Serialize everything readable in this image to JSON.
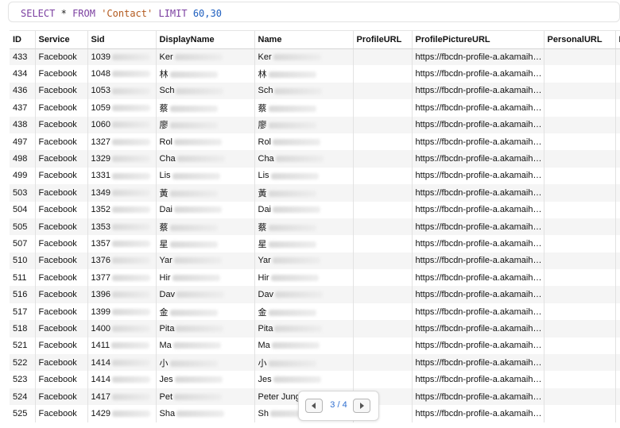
{
  "query": {
    "select": "SELECT",
    "star": "*",
    "from": "FROM",
    "table": "'Contact'",
    "limit": "LIMIT",
    "range": "60,30"
  },
  "columns": [
    "ID",
    "Service",
    "Sid",
    "DisplayName",
    "Name",
    "ProfileURL",
    "ProfilePictureURL",
    "PersonalURL",
    "I"
  ],
  "rows": [
    {
      "id": "433",
      "service": "Facebook",
      "sid": "1039",
      "display": "Ker",
      "name": "Ker",
      "pic": "https://fbcdn-profile-a.akamaih…"
    },
    {
      "id": "434",
      "service": "Facebook",
      "sid": "1048",
      "display": "林​",
      "name": "林",
      "pic": "https://fbcdn-profile-a.akamaih…"
    },
    {
      "id": "436",
      "service": "Facebook",
      "sid": "1053",
      "display": "Sch",
      "name": "Sch",
      "pic": "https://fbcdn-profile-a.akamaih…"
    },
    {
      "id": "437",
      "service": "Facebook",
      "sid": "1059",
      "display": "蔡",
      "name": "蔡",
      "pic": "https://fbcdn-profile-a.akamaih…"
    },
    {
      "id": "438",
      "service": "Facebook",
      "sid": "1060",
      "display": "廖",
      "name": "廖",
      "pic": "https://fbcdn-profile-a.akamaih…"
    },
    {
      "id": "497",
      "service": "Facebook",
      "sid": "1327",
      "display": "Rol",
      "name": "Rol",
      "pic": "https://fbcdn-profile-a.akamaih…"
    },
    {
      "id": "498",
      "service": "Facebook",
      "sid": "1329",
      "display": "Cha",
      "name": "Cha",
      "pic": "https://fbcdn-profile-a.akamaih…"
    },
    {
      "id": "499",
      "service": "Facebook",
      "sid": "1331",
      "display": "Lis",
      "name": "Lis",
      "pic": "https://fbcdn-profile-a.akamaih…"
    },
    {
      "id": "503",
      "service": "Facebook",
      "sid": "1349",
      "display": "黃",
      "name": "黃",
      "pic": "https://fbcdn-profile-a.akamaih…"
    },
    {
      "id": "504",
      "service": "Facebook",
      "sid": "1352",
      "display": "Dai",
      "name": "Dai",
      "pic": "https://fbcdn-profile-a.akamaih…"
    },
    {
      "id": "505",
      "service": "Facebook",
      "sid": "1353",
      "display": "蔡",
      "name": "蔡",
      "pic": "https://fbcdn-profile-a.akamaih…"
    },
    {
      "id": "507",
      "service": "Facebook",
      "sid": "1357",
      "display": "星",
      "name": "星",
      "pic": "https://fbcdn-profile-a.akamaih…"
    },
    {
      "id": "510",
      "service": "Facebook",
      "sid": "1376",
      "display": "Yar",
      "name": "Yar",
      "pic": "https://fbcdn-profile-a.akamaih…"
    },
    {
      "id": "511",
      "service": "Facebook",
      "sid": "1377",
      "display": "Hir",
      "name": "Hir",
      "pic": "https://fbcdn-profile-a.akamaih…"
    },
    {
      "id": "516",
      "service": "Facebook",
      "sid": "1396",
      "display": "Dav",
      "name": "Dav",
      "pic": "https://fbcdn-profile-a.akamaih…"
    },
    {
      "id": "517",
      "service": "Facebook",
      "sid": "1399",
      "display": "金",
      "name": "金",
      "pic": "https://fbcdn-profile-a.akamaih…"
    },
    {
      "id": "518",
      "service": "Facebook",
      "sid": "1400",
      "display": "Pita",
      "name": "Pita",
      "pic": "https://fbcdn-profile-a.akamaih…"
    },
    {
      "id": "521",
      "service": "Facebook",
      "sid": "1411",
      "display": "Ma",
      "name": "Ma",
      "pic": "https://fbcdn-profile-a.akamaih…"
    },
    {
      "id": "522",
      "service": "Facebook",
      "sid": "1414",
      "display": "小",
      "name": "小",
      "pic": "https://fbcdn-profile-a.akamaih…"
    },
    {
      "id": "523",
      "service": "Facebook",
      "sid": "1414",
      "display": "Jes",
      "name": "Jes",
      "pic": "https://fbcdn-profile-a.akamaih…"
    },
    {
      "id": "524",
      "service": "Facebook",
      "sid": "1417",
      "display": "Pet",
      "name": "Peter Jung",
      "pic": "https://fbcdn-profile-a.akamaih…"
    },
    {
      "id": "525",
      "service": "Facebook",
      "sid": "1429",
      "display": "Sha",
      "name": "Sh",
      "pic": "https://fbcdn-profile-a.akamaih…"
    }
  ],
  "pager": {
    "label": "3 / 4",
    "prev_icon": "chevron-left-icon",
    "next_icon": "chevron-right-icon"
  },
  "colors": {
    "keyword": "#7b3fa0",
    "string": "#b35a1f",
    "number": "#1f5fbf",
    "pager_text": "#2f6fd0",
    "row_stripe": "#f5f5f5"
  }
}
